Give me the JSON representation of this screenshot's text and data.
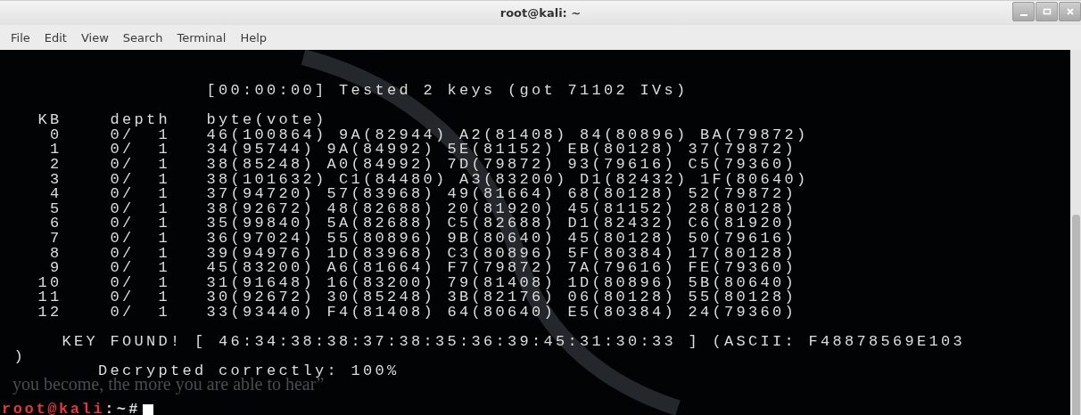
{
  "window": {
    "title": "root@kali: ~"
  },
  "menu": [
    "File",
    "Edit",
    "View",
    "Search",
    "Terminal",
    "Help"
  ],
  "terminal": {
    "status_line": "[00:00:00] Tested 2 keys (got 71102 IVs)",
    "columns": [
      "KB",
      "depth",
      "byte(vote)"
    ],
    "rows": [
      {
        "kb": "0",
        "depth": "0/  1",
        "votes": "46(100864) 9A(82944) A2(81408) 84(80896) BA(79872)"
      },
      {
        "kb": "1",
        "depth": "0/  1",
        "votes": "34(95744) 9A(84992) 5E(81152) EB(80128) 37(79872)"
      },
      {
        "kb": "2",
        "depth": "0/  1",
        "votes": "38(85248) A0(84992) 7D(79872) 93(79616) C5(79360)"
      },
      {
        "kb": "3",
        "depth": "0/  1",
        "votes": "38(101632) C1(84480) A3(83200) D1(82432) 1F(80640)"
      },
      {
        "kb": "4",
        "depth": "0/  1",
        "votes": "37(94720) 57(83968) 49(81664) 68(80128) 52(79872)"
      },
      {
        "kb": "5",
        "depth": "0/  1",
        "votes": "38(92672) 48(82688) 20(81920) 45(81152) 28(80128)"
      },
      {
        "kb": "6",
        "depth": "0/  1",
        "votes": "35(99840) 5A(82688) C5(82688) D1(82432) C6(81920)"
      },
      {
        "kb": "7",
        "depth": "0/  1",
        "votes": "36(97024) 55(80896) 9B(80640) 45(80128) 50(79616)"
      },
      {
        "kb": "8",
        "depth": "0/  1",
        "votes": "39(94976) 1D(83968) C3(80896) 5F(80384) 17(80128)"
      },
      {
        "kb": "9",
        "depth": "0/  1",
        "votes": "45(83200) A6(81664) F7(79872) 7A(79616) FE(79360)"
      },
      {
        "kb": "10",
        "depth": "0/  1",
        "votes": "31(91648) 16(83200) 79(81408) 1D(80896) 5B(80640)"
      },
      {
        "kb": "11",
        "depth": "0/  1",
        "votes": "30(92672) 30(85248) 3B(82176) 06(80128) 55(80128)"
      },
      {
        "kb": "12",
        "depth": "0/  1",
        "votes": "33(93440) F4(81408) 64(80640) E5(80384) 24(79360)"
      }
    ],
    "key_line": "KEY FOUND! [ 46:34:38:38:37:38:35:36:39:45:31:30:33 ] (ASCII: F48878569E103",
    "key_line_wrap": ")",
    "result_line": "Decrypted correctly: 100%",
    "prompt": {
      "user_host": "root@kali",
      "suffix": ":~#"
    }
  },
  "wallpaper": {
    "quote": "you become, the more you are able to hear”"
  }
}
